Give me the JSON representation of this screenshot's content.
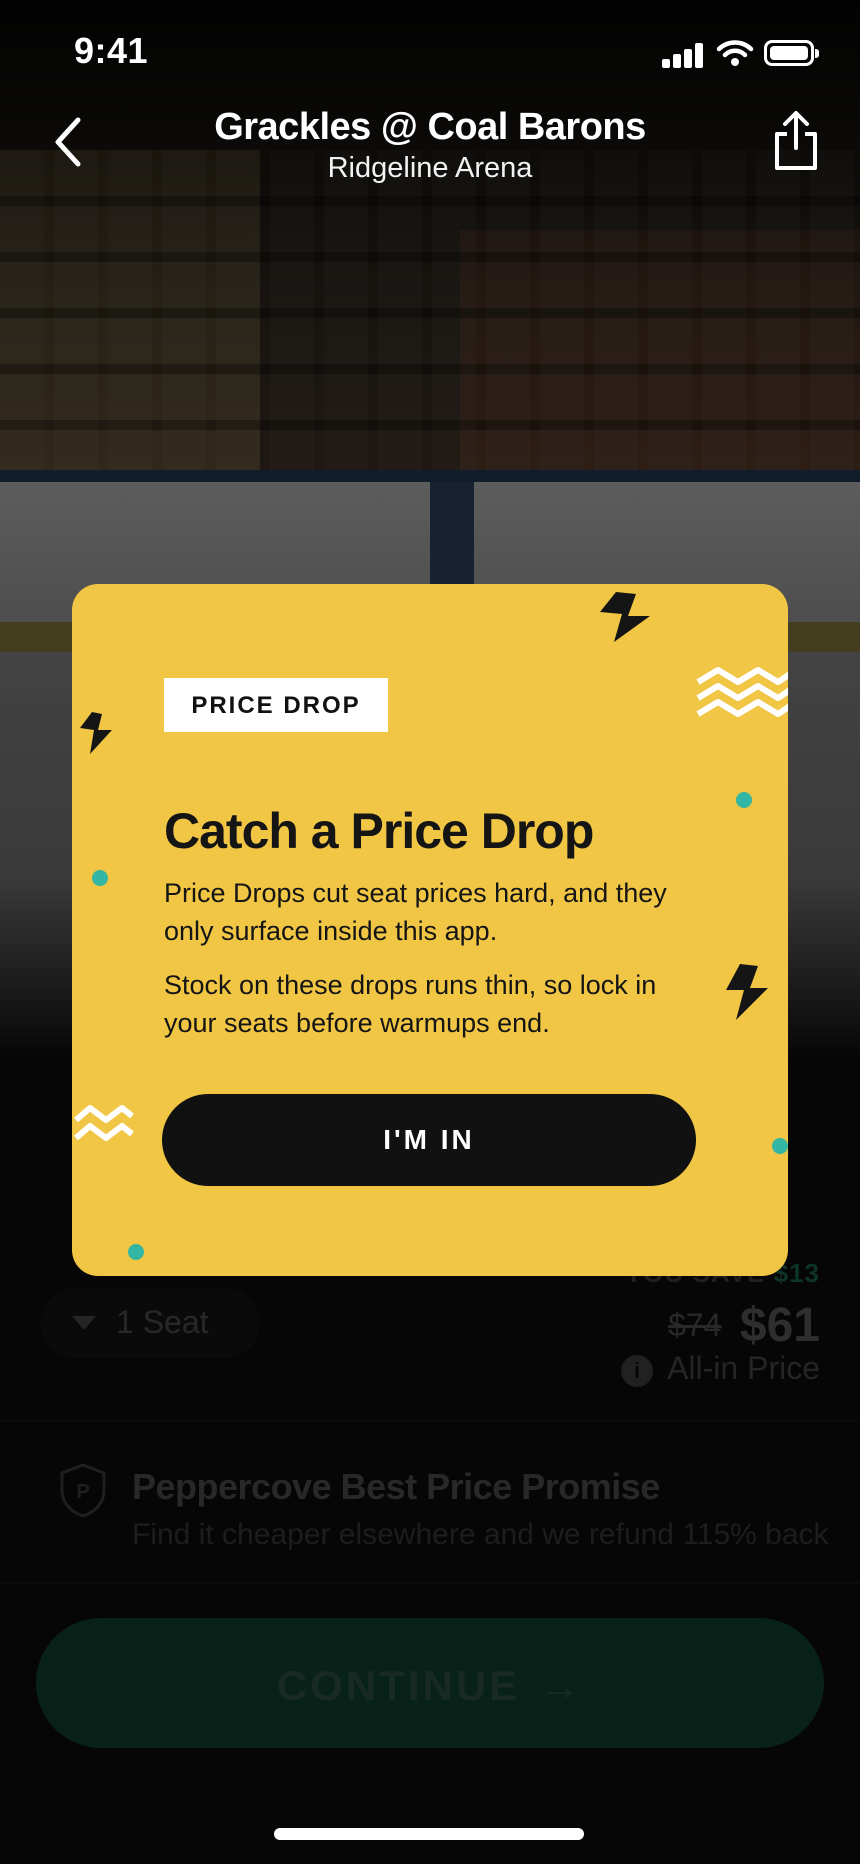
{
  "status_bar": {
    "time": "9:41"
  },
  "header": {
    "title": "Grackles @ Coal Barons",
    "subtitle": "Ridgeline Arena"
  },
  "modal": {
    "badge": "PRICE DROP",
    "title": "Catch a Price Drop",
    "paragraph_1": "Price Drops cut seat prices hard, and they only surface inside this app.",
    "paragraph_2": "Stock on these drops runs thin, so lock in your seats before warmups end.",
    "button_label": "I'M IN"
  },
  "ticket": {
    "seat_label": "1 Seat",
    "you_save_label": "YOU SAVE",
    "you_save_amount": "$13",
    "old_price": "$74",
    "new_price": "$61",
    "price_note": "All-in Price",
    "info_glyph": "i"
  },
  "promise": {
    "icon_letter": "P",
    "title": "Peppercove Best Price Promise",
    "subtitle": "Find it cheaper elsewhere and we refund 115% back"
  },
  "continue": {
    "label": "CONTINUE",
    "arrow": "→"
  },
  "colors": {
    "modal_background": "#f1c644",
    "accent_teal": "#33b6a3",
    "continue_button": "#0f3d2e",
    "save_amount_green": "#1a5e48"
  },
  "icons": {
    "back": "chevron-left-icon",
    "share": "share-icon",
    "seat_dropdown": "caret-down-icon",
    "info": "info-icon",
    "promise": "shield-icon"
  }
}
